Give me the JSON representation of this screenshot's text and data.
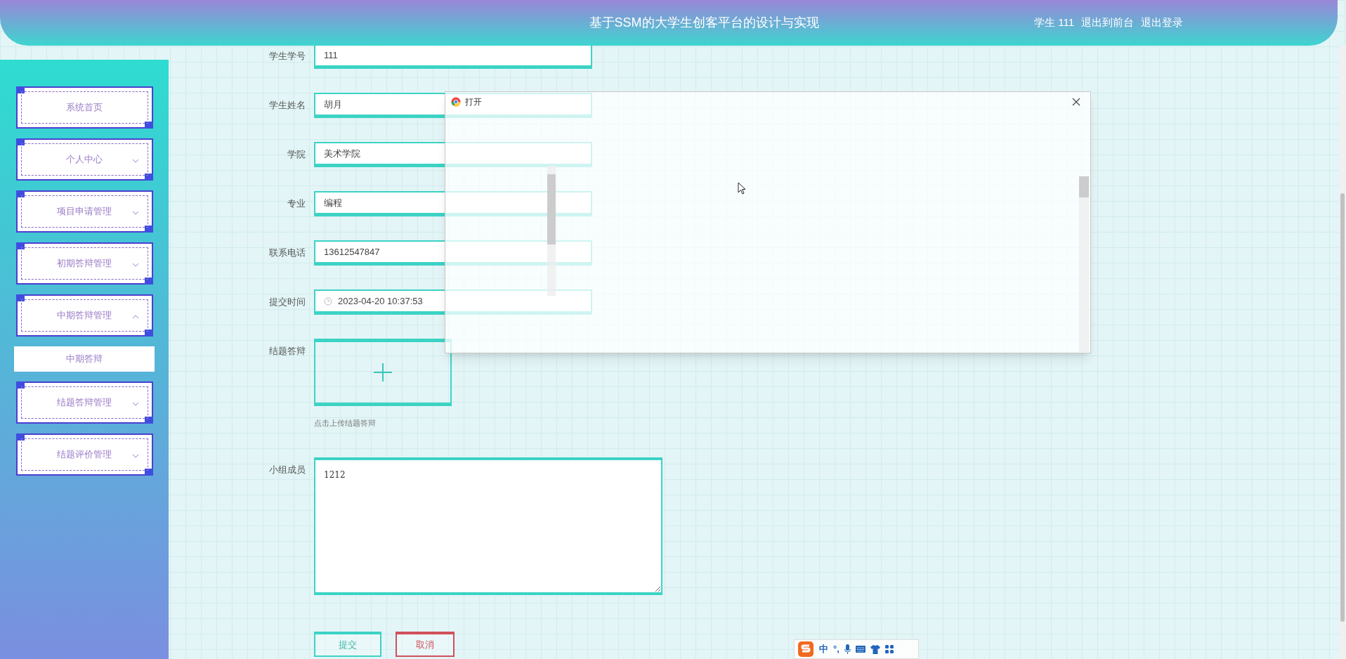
{
  "header": {
    "title": "基于SSM的大学生创客平台的设计与实现",
    "user_label": "学生 111",
    "links": [
      "退出到前台",
      "退出登录"
    ]
  },
  "sidebar": {
    "items": [
      {
        "label": "系统首页",
        "has_children": false
      },
      {
        "label": "个人中心",
        "has_children": true,
        "expanded": false
      },
      {
        "label": "项目申请管理",
        "has_children": true,
        "expanded": false
      },
      {
        "label": "初期答辩管理",
        "has_children": true,
        "expanded": false
      },
      {
        "label": "中期答辩管理",
        "has_children": true,
        "expanded": true,
        "children": [
          {
            "label": "中期答辩",
            "selected": true
          }
        ]
      },
      {
        "label": "结题答辩管理",
        "has_children": true,
        "expanded": false
      },
      {
        "label": "结题评价管理",
        "has_children": true,
        "expanded": false
      }
    ]
  },
  "form": {
    "fields": [
      {
        "label": "学生学号",
        "kind": "text",
        "value": "111"
      },
      {
        "label": "学生姓名",
        "kind": "text",
        "value": "胡月"
      },
      {
        "label": "学院",
        "kind": "text",
        "value": "美术学院"
      },
      {
        "label": "专业",
        "kind": "text",
        "value": "编程"
      },
      {
        "label": "联系电话",
        "kind": "text",
        "value": "13612547847"
      },
      {
        "label": "提交时间",
        "kind": "datetime",
        "value": "2023-04-20 10:37:53"
      }
    ],
    "upload": {
      "label": "结题答辩",
      "hint": "点击上传结题答辩"
    },
    "members": {
      "label": "小组成员",
      "value": "1212"
    },
    "buttons": [
      {
        "label": "提交",
        "kind": "primary"
      },
      {
        "label": "取消",
        "kind": "danger"
      }
    ]
  },
  "dialog": {
    "title": "打开"
  },
  "ime": {
    "items": [
      "中",
      "°,"
    ]
  }
}
